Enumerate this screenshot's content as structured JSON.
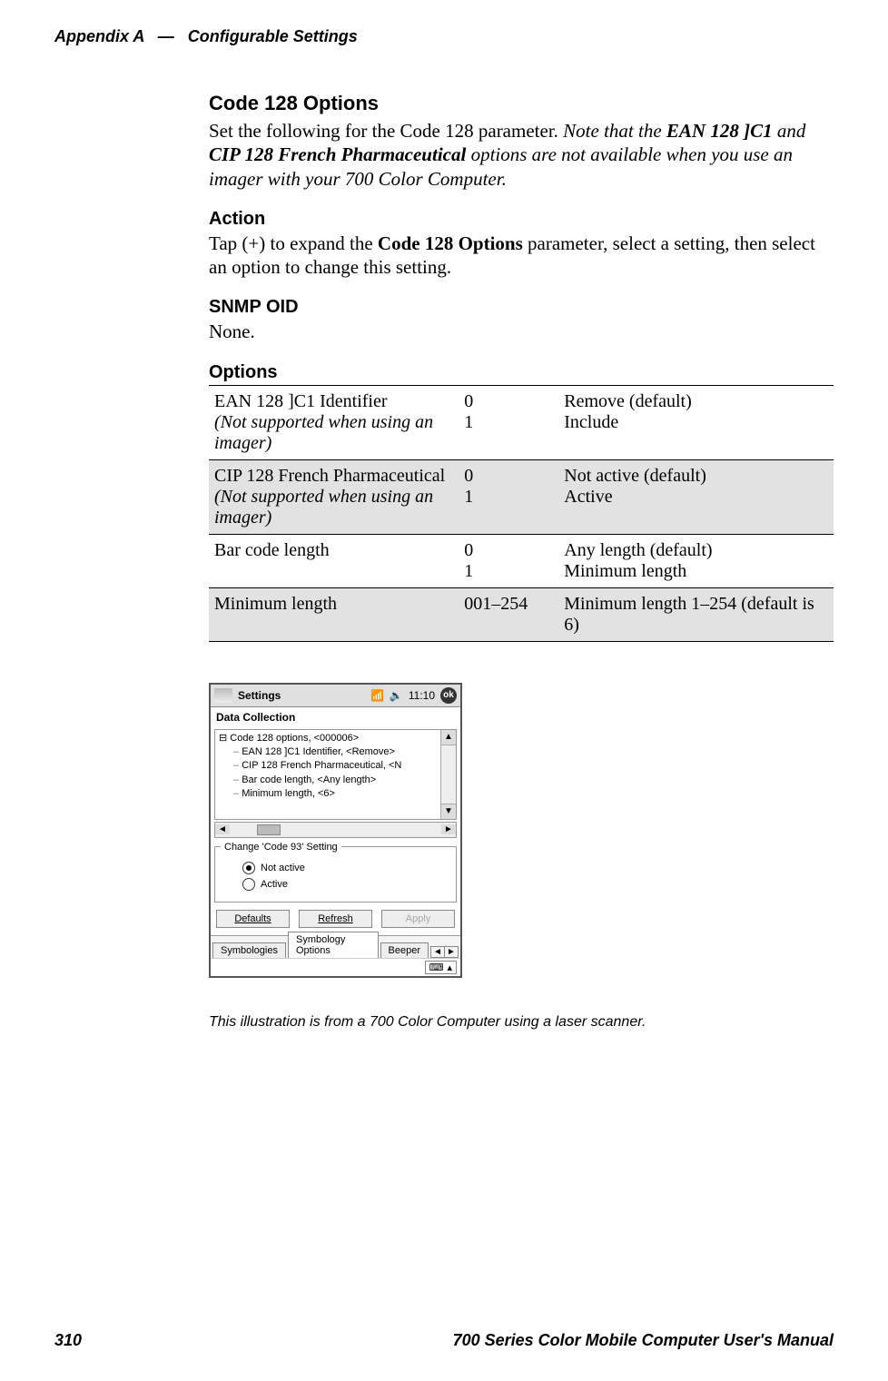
{
  "header": {
    "left": "Appendix  A",
    "sep": "—",
    "right": "Configurable Settings"
  },
  "sections": {
    "title": "Code 128 Options",
    "intro_plain": "Set the following for the Code 128 parameter. ",
    "intro_italic_prefix": "Note that the ",
    "intro_bold1": "EAN 128 ]C1",
    "intro_mid": " and ",
    "intro_bold2": "CIP 128 French Pharmaceutical",
    "intro_italic_suffix": " options are not available when you use an imager with your 700 Color Computer.",
    "action_h": "Action",
    "action_pre": "Tap (+) to expand the ",
    "action_bold": "Code 128 Options",
    "action_post": " parameter, select a setting, then select an option to change this setting.",
    "snmp_h": "SNMP OID",
    "snmp_body": "None.",
    "options_h": "Options"
  },
  "options_table": [
    {
      "name_main": "EAN 128 ]C1 Identifier",
      "name_note": "(Not supported when using an imager)",
      "codes": "0\n1",
      "values": "Remove (default)\nInclude",
      "shaded": false
    },
    {
      "name_main": "CIP 128 French Pharmaceutical",
      "name_note": "(Not supported when using an imager)",
      "codes": "0\n1",
      "values": "Not active (default)\nActive",
      "shaded": true
    },
    {
      "name_main": "Bar code length",
      "name_note": "",
      "codes": "0\n1",
      "values": "Any length (default)\nMinimum length",
      "shaded": false
    },
    {
      "name_main": "Minimum length",
      "name_note": "",
      "codes": "001–254",
      "values": "Minimum length 1–254 (default is 6)",
      "shaded": true
    }
  ],
  "device": {
    "status_title": "Settings",
    "status_time": "11:10",
    "ok": "ok",
    "app_title": "Data Collection",
    "tree": [
      "Code 128 options, <000006>",
      "EAN 128 ]C1 Identifier, <Remove>",
      "CIP 128 French Pharmaceutical, <N",
      "Bar code length, <Any length>",
      "Minimum length, <6>"
    ],
    "group_legend": "Change 'Code 93' Setting",
    "radio_notactive": "Not active",
    "radio_active": "Active",
    "btn_defaults": "Defaults",
    "btn_refresh": "Refresh",
    "btn_apply": "Apply",
    "tab1": "Symbologies",
    "tab2": "Symbology Options",
    "tab3": "Beeper"
  },
  "caption": "This illustration is  from a 700  Color Computer using a laser scanner.",
  "footer": {
    "page": "310",
    "manual": "700 Series Color Mobile Computer User's Manual"
  }
}
